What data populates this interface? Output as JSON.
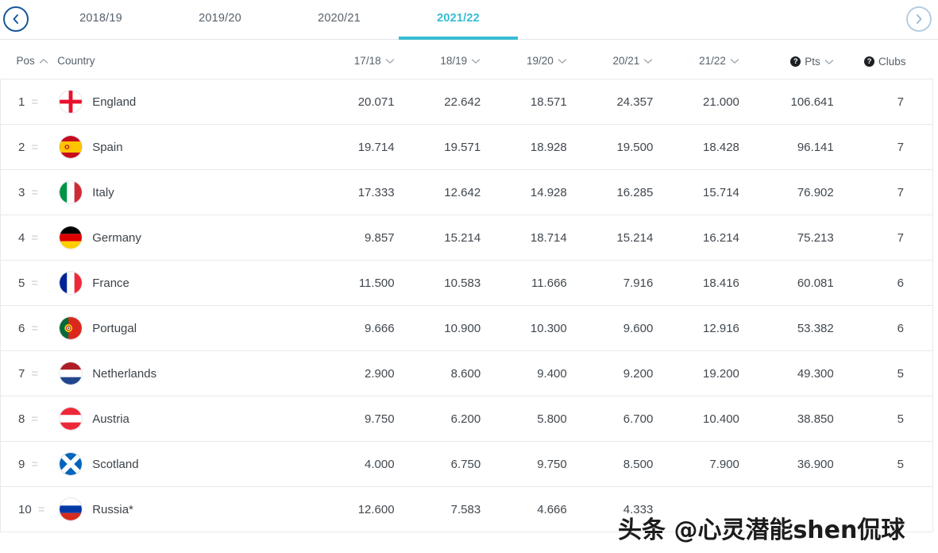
{
  "nav": {
    "prev_label": "previous-seasons",
    "next_label": "next-seasons"
  },
  "tabs": [
    {
      "label": "2018/19",
      "active": false
    },
    {
      "label": "2019/20",
      "active": false
    },
    {
      "label": "2020/21",
      "active": false
    },
    {
      "label": "2021/22",
      "active": true
    }
  ],
  "accent_color": "#37bcd4",
  "columns": [
    {
      "key": "pos",
      "label": "Pos",
      "sort": "asc",
      "help": false
    },
    {
      "key": "country",
      "label": "Country",
      "sort": "none",
      "help": false
    },
    {
      "key": "s1718",
      "label": "17/18",
      "sort": "down",
      "help": false
    },
    {
      "key": "s1819",
      "label": "18/19",
      "sort": "down",
      "help": false
    },
    {
      "key": "s1920",
      "label": "19/20",
      "sort": "down",
      "help": false
    },
    {
      "key": "s2021",
      "label": "20/21",
      "sort": "down",
      "help": false
    },
    {
      "key": "s2122",
      "label": "21/22",
      "sort": "down",
      "help": false
    },
    {
      "key": "pts",
      "label": "Pts",
      "sort": "down",
      "help": true
    },
    {
      "key": "clubs",
      "label": "Clubs",
      "sort": "none",
      "help": true
    }
  ],
  "rows": [
    {
      "pos": "1",
      "move": "=",
      "country": "England",
      "flag": "england",
      "s1718": "20.071",
      "s1819": "22.642",
      "s1920": "18.571",
      "s2021": "24.357",
      "s2122": "21.000",
      "pts": "106.641",
      "clubs": "7"
    },
    {
      "pos": "2",
      "move": "=",
      "country": "Spain",
      "flag": "spain",
      "s1718": "19.714",
      "s1819": "19.571",
      "s1920": "18.928",
      "s2021": "19.500",
      "s2122": "18.428",
      "pts": "96.141",
      "clubs": "7"
    },
    {
      "pos": "3",
      "move": "=",
      "country": "Italy",
      "flag": "italy",
      "s1718": "17.333",
      "s1819": "12.642",
      "s1920": "14.928",
      "s2021": "16.285",
      "s2122": "15.714",
      "pts": "76.902",
      "clubs": "7"
    },
    {
      "pos": "4",
      "move": "=",
      "country": "Germany",
      "flag": "germany",
      "s1718": "9.857",
      "s1819": "15.214",
      "s1920": "18.714",
      "s2021": "15.214",
      "s2122": "16.214",
      "pts": "75.213",
      "clubs": "7"
    },
    {
      "pos": "5",
      "move": "=",
      "country": "France",
      "flag": "france",
      "s1718": "11.500",
      "s1819": "10.583",
      "s1920": "11.666",
      "s2021": "7.916",
      "s2122": "18.416",
      "pts": "60.081",
      "clubs": "6"
    },
    {
      "pos": "6",
      "move": "=",
      "country": "Portugal",
      "flag": "portugal",
      "s1718": "9.666",
      "s1819": "10.900",
      "s1920": "10.300",
      "s2021": "9.600",
      "s2122": "12.916",
      "pts": "53.382",
      "clubs": "6"
    },
    {
      "pos": "7",
      "move": "=",
      "country": "Netherlands",
      "flag": "netherlands",
      "s1718": "2.900",
      "s1819": "8.600",
      "s1920": "9.400",
      "s2021": "9.200",
      "s2122": "19.200",
      "pts": "49.300",
      "clubs": "5"
    },
    {
      "pos": "8",
      "move": "=",
      "country": "Austria",
      "flag": "austria",
      "s1718": "9.750",
      "s1819": "6.200",
      "s1920": "5.800",
      "s2021": "6.700",
      "s2122": "10.400",
      "pts": "38.850",
      "clubs": "5"
    },
    {
      "pos": "9",
      "move": "=",
      "country": "Scotland",
      "flag": "scotland",
      "s1718": "4.000",
      "s1819": "6.750",
      "s1920": "9.750",
      "s2021": "8.500",
      "s2122": "7.900",
      "pts": "36.900",
      "clubs": "5"
    },
    {
      "pos": "10",
      "move": "=",
      "country": "Russia*",
      "flag": "russia",
      "s1718": "12.600",
      "s1819": "7.583",
      "s1920": "4.666",
      "s2021": "4.333",
      "s2122": "",
      "pts": "",
      "clubs": ""
    }
  ],
  "watermark": {
    "text": "头条 @心灵潜能shen侃球"
  }
}
